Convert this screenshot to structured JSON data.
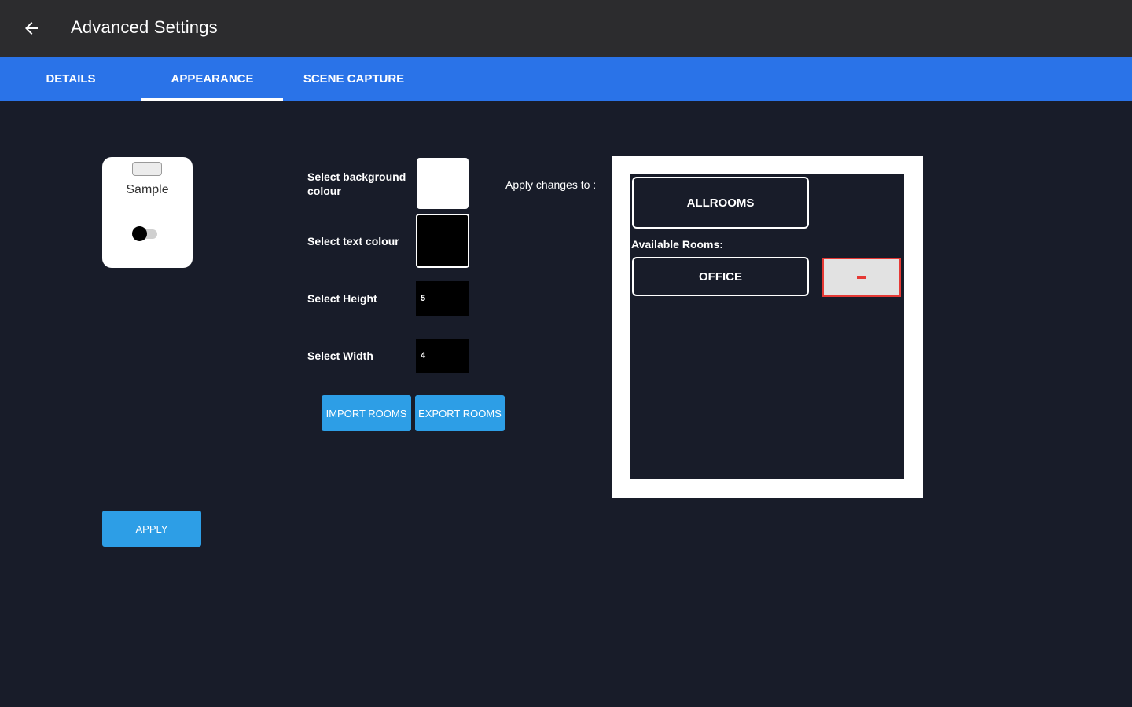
{
  "appbar": {
    "title": "Advanced Settings",
    "back_icon": "arrow-left-icon"
  },
  "tabs": [
    {
      "label": "DETAILS",
      "active": false
    },
    {
      "label": "APPEARANCE",
      "active": true
    },
    {
      "label": "SCENE CAPTURE",
      "active": false
    }
  ],
  "preview": {
    "label": "Sample",
    "background_color": "#ffffff",
    "text_color": "#333333"
  },
  "appearance_form": {
    "background_label": "Select background colour",
    "background_value": "#ffffff",
    "text_label": "Select text colour",
    "text_value": "#000000",
    "height_label": "Select Height",
    "height_value": "5",
    "width_label": "Select Width",
    "width_value": "4"
  },
  "actions": {
    "import_label": "IMPORT ROOMS",
    "export_label": "EXPORT ROOMS",
    "apply_label": "APPLY"
  },
  "rooms": {
    "apply_to_label": "Apply changes to :",
    "all_rooms_label": "ALLROOMS",
    "available_label": "Available Rooms:",
    "items": [
      {
        "label": "OFFICE",
        "remove_icon": "minus-icon"
      }
    ]
  },
  "colors": {
    "appbar": "#2c2c2e",
    "tabbar": "#2a73e8",
    "page": "#181c29",
    "button": "#2d9ee6",
    "remove_accent": "#e53935"
  }
}
